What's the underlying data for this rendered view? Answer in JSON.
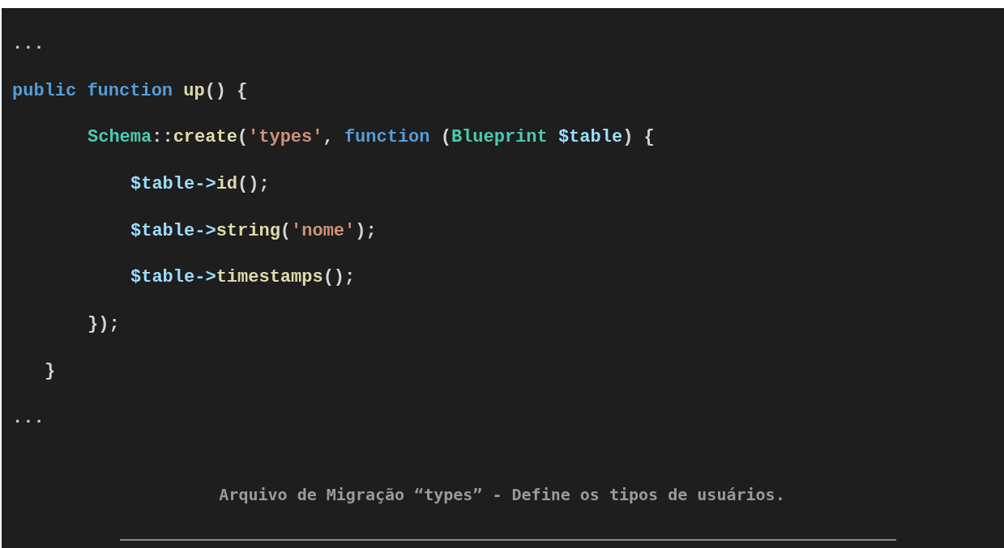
{
  "code_lines": [
    {
      "kind": "top",
      "tokens": [
        {
          "kind": "plain",
          "text": "..."
        }
      ]
    },
    {
      "kind": "top",
      "tokens": [
        {
          "kind": "keyword",
          "text": "public function "
        },
        {
          "kind": "function",
          "text": "up"
        },
        {
          "kind": "punct",
          "text": "() {"
        }
      ]
    },
    {
      "kind": "body",
      "tokens": [
        {
          "kind": "class",
          "text": "Schema"
        },
        {
          "kind": "punct",
          "text": "::"
        },
        {
          "kind": "function",
          "text": "create"
        },
        {
          "kind": "punct",
          "text": "("
        },
        {
          "kind": "string",
          "text": "'types'"
        },
        {
          "kind": "punct",
          "text": ", "
        },
        {
          "kind": "keyword",
          "text": "function"
        },
        {
          "kind": "punct",
          "text": " ("
        },
        {
          "kind": "class",
          "text": "Blueprint"
        },
        {
          "kind": "variable",
          "text": "$table",
          "spaced": true
        },
        {
          "kind": "punct",
          "text": ") {"
        }
      ]
    },
    {
      "kind": "inner",
      "tokens": [
        {
          "kind": "variable",
          "text": "$table->"
        },
        {
          "kind": "function",
          "text": "id"
        },
        {
          "kind": "punct",
          "text": "();"
        }
      ]
    },
    {
      "kind": "inner",
      "tokens": [
        {
          "kind": "variable",
          "text": "$table->"
        },
        {
          "kind": "function",
          "text": "string"
        },
        {
          "kind": "punct",
          "text": "("
        },
        {
          "kind": "string",
          "text": "'nome'"
        },
        {
          "kind": "punct",
          "text": ");"
        }
      ]
    },
    {
      "kind": "inner",
      "tokens": [
        {
          "kind": "variable",
          "text": "$table->"
        },
        {
          "kind": "function",
          "text": "timestamps"
        },
        {
          "kind": "punct",
          "text": "();"
        }
      ]
    },
    {
      "kind": "body",
      "tokens": [
        {
          "kind": "punct",
          "text": "});"
        }
      ]
    },
    {
      "kind": "method",
      "tokens": [
        {
          "kind": "punct",
          "text": "}"
        }
      ]
    },
    {
      "kind": "top",
      "tokens": [
        {
          "kind": "plain",
          "text": "..."
        }
      ]
    }
  ],
  "caption": "Arquivo de Migração “types” - Define os tipos de usuários."
}
